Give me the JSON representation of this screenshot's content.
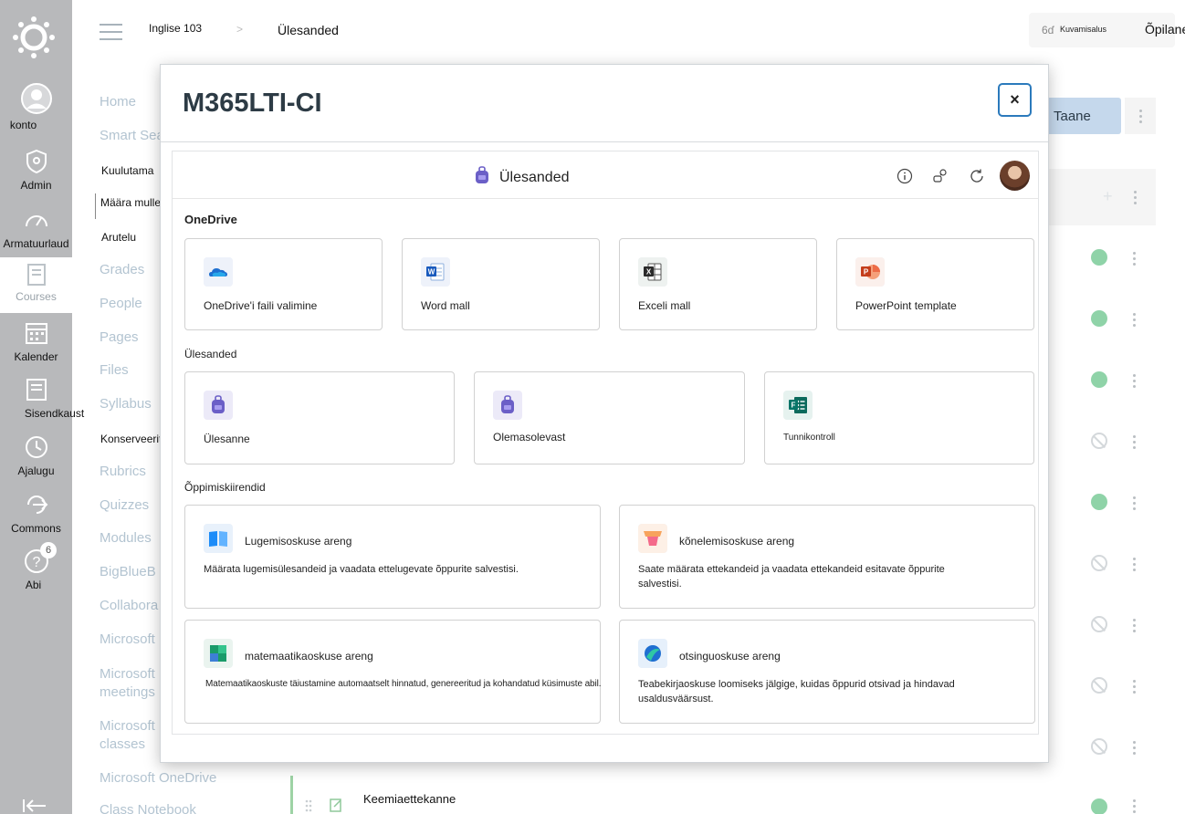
{
  "global_nav": {
    "items": [
      {
        "label": "konto",
        "icon": "account-icon"
      },
      {
        "label": "Admin",
        "icon": "admin-shield-icon"
      },
      {
        "label": "Armatuurlaud",
        "icon": "dashboard-gauge-icon"
      },
      {
        "label": "Courses",
        "icon": "courses-book-icon"
      },
      {
        "label": "Kalender",
        "icon": "calendar-icon"
      },
      {
        "label": "Sisendkaust",
        "icon": "inbox-icon"
      },
      {
        "label": "Ajalugu",
        "icon": "history-clock-icon"
      },
      {
        "label": "Commons",
        "icon": "commons-icon"
      },
      {
        "label": "Abi",
        "icon": "help-icon"
      }
    ],
    "help_badge": "6"
  },
  "breadcrumb": {
    "course": "Inglise 103",
    "page": "Ülesanded"
  },
  "header_right": {
    "immersive": "Kuvamisalus",
    "role": "Õpilane"
  },
  "course_nav": {
    "items": [
      "Home",
      "Smart Sea",
      "Kuulutama",
      "Määra mulle",
      "Arutelu",
      "Grades",
      "People",
      "Pages",
      "Files",
      "Syllabus",
      "Konserveeritud",
      "Rubrics",
      "Quizzes",
      "Modules",
      "BigBlueB",
      "Collabora",
      "Microsoft",
      "Microsoft meetings",
      "Microsoft classes",
      "Microsoft OneDrive",
      "Class Notebook"
    ]
  },
  "page_actions": {
    "today": "Taane"
  },
  "bottom_row": {
    "title": "Keemiaettekanne"
  },
  "modal": {
    "title": "M365LTI-CI",
    "close_glyph": "×",
    "app": {
      "title": "Ülesanded",
      "sections": {
        "onedrive": {
          "title": "OneDrive",
          "cards": [
            {
              "label": "OneDrive'i faili valimine",
              "icon": "onedrive-cloud-icon"
            },
            {
              "label": "Word mall",
              "icon": "word-icon"
            },
            {
              "label": "Exceli mall",
              "icon": "excel-icon"
            },
            {
              "label": "PowerPoint template",
              "icon": "powerpoint-icon"
            }
          ]
        },
        "assignments": {
          "title": "Ülesanded",
          "cards": [
            {
              "label": "Ülesanne",
              "icon": "backpack-icon"
            },
            {
              "label": "Olemasolevast",
              "icon": "backpack-icon"
            },
            {
              "label": "Tunnikontroll",
              "icon": "forms-icon"
            }
          ]
        },
        "accelerators": {
          "title": "Õppimiskiirendid",
          "cards": [
            {
              "label": "Lugemisoskuse areng",
              "desc": "Määrata lugemisülesandeid ja vaadata ettelugevate õppurite salvestisi.",
              "icon": "reading-book-icon"
            },
            {
              "label": "kõnelemisoskuse areng",
              "desc": "Saate määrata ettekandeid ja vaadata ettekandeid esitavate õppurite salvestisi.",
              "icon": "speaker-podium-icon"
            },
            {
              "label": "matemaatikaoskuse areng",
              "desc": "Matemaatikaoskuste täiustamine automaatselt hinnatud, genereeritud ja kohandatud küsimuste abil.",
              "icon": "math-icon"
            },
            {
              "label": "otsinguoskuse areng",
              "desc": "Teabekirjaoskuse loomiseks jälgige, kuidas õppurid otsivad ja hindavad usaldusväärsust.",
              "icon": "search-globe-icon"
            }
          ]
        }
      }
    }
  }
}
